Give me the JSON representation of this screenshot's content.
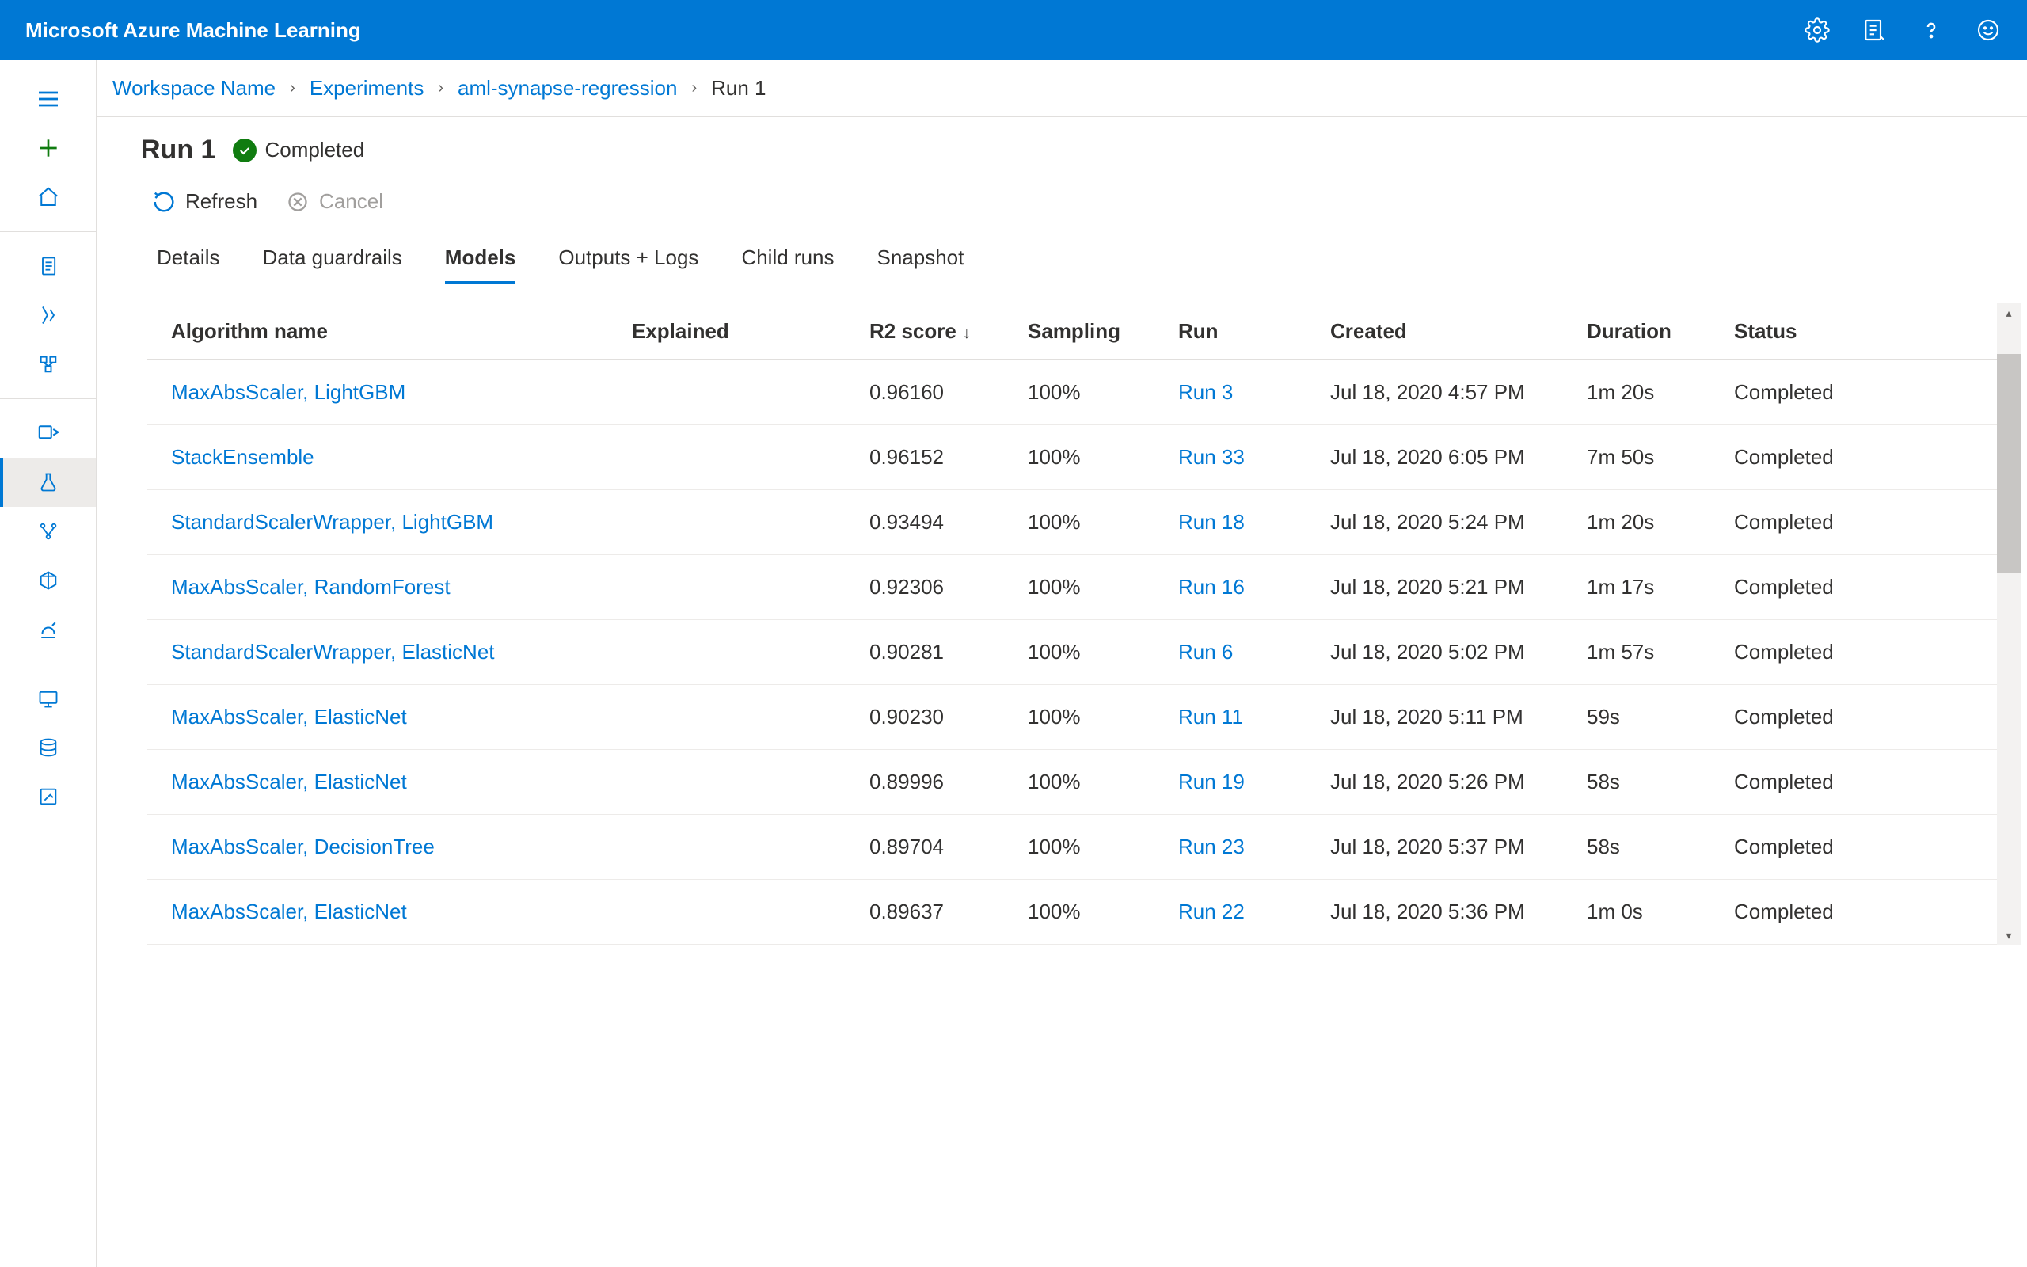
{
  "app": {
    "title": "Microsoft Azure Machine Learning"
  },
  "breadcrumb": {
    "workspace": "Workspace Name",
    "experiments": "Experiments",
    "experiment_name": "aml-synapse-regression",
    "run": "Run 1"
  },
  "page": {
    "title": "Run 1",
    "status_label": "Completed"
  },
  "commands": {
    "refresh": "Refresh",
    "cancel": "Cancel"
  },
  "tabs": {
    "details": "Details",
    "guardrails": "Data guardrails",
    "models": "Models",
    "outputs": "Outputs + Logs",
    "child_runs": "Child runs",
    "snapshot": "Snapshot"
  },
  "table": {
    "headers": {
      "algorithm": "Algorithm name",
      "explained": "Explained",
      "r2": "R2 score",
      "sampling": "Sampling",
      "run": "Run",
      "created": "Created",
      "duration": "Duration",
      "status": "Status"
    },
    "rows": [
      {
        "algorithm": "MaxAbsScaler, LightGBM",
        "explained": "",
        "r2": "0.96160",
        "sampling": "100%",
        "run": "Run 3",
        "created": "Jul 18, 2020 4:57 PM",
        "duration": "1m 20s",
        "status": "Completed"
      },
      {
        "algorithm": "StackEnsemble",
        "explained": "",
        "r2": "0.96152",
        "sampling": "100%",
        "run": "Run 33",
        "created": "Jul 18, 2020 6:05 PM",
        "duration": "7m 50s",
        "status": "Completed"
      },
      {
        "algorithm": "StandardScalerWrapper, LightGBM",
        "explained": "",
        "r2": "0.93494",
        "sampling": "100%",
        "run": "Run 18",
        "created": "Jul 18, 2020 5:24 PM",
        "duration": "1m 20s",
        "status": "Completed"
      },
      {
        "algorithm": "MaxAbsScaler, RandomForest",
        "explained": "",
        "r2": "0.92306",
        "sampling": "100%",
        "run": "Run 16",
        "created": "Jul 18, 2020 5:21 PM",
        "duration": "1m 17s",
        "status": "Completed"
      },
      {
        "algorithm": "StandardScalerWrapper, ElasticNet",
        "explained": "",
        "r2": "0.90281",
        "sampling": "100%",
        "run": "Run 6",
        "created": "Jul 18, 2020 5:02 PM",
        "duration": "1m 57s",
        "status": "Completed"
      },
      {
        "algorithm": "MaxAbsScaler, ElasticNet",
        "explained": "",
        "r2": "0.90230",
        "sampling": "100%",
        "run": "Run 11",
        "created": "Jul 18, 2020 5:11 PM",
        "duration": "59s",
        "status": "Completed"
      },
      {
        "algorithm": "MaxAbsScaler, ElasticNet",
        "explained": "",
        "r2": "0.89996",
        "sampling": "100%",
        "run": "Run 19",
        "created": "Jul 18, 2020 5:26 PM",
        "duration": "58s",
        "status": "Completed"
      },
      {
        "algorithm": "MaxAbsScaler, DecisionTree",
        "explained": "",
        "r2": "0.89704",
        "sampling": "100%",
        "run": "Run 23",
        "created": "Jul 18, 2020 5:37 PM",
        "duration": "58s",
        "status": "Completed"
      },
      {
        "algorithm": "MaxAbsScaler, ElasticNet",
        "explained": "",
        "r2": "0.89637",
        "sampling": "100%",
        "run": "Run 22",
        "created": "Jul 18, 2020 5:36 PM",
        "duration": "1m 0s",
        "status": "Completed"
      }
    ]
  }
}
